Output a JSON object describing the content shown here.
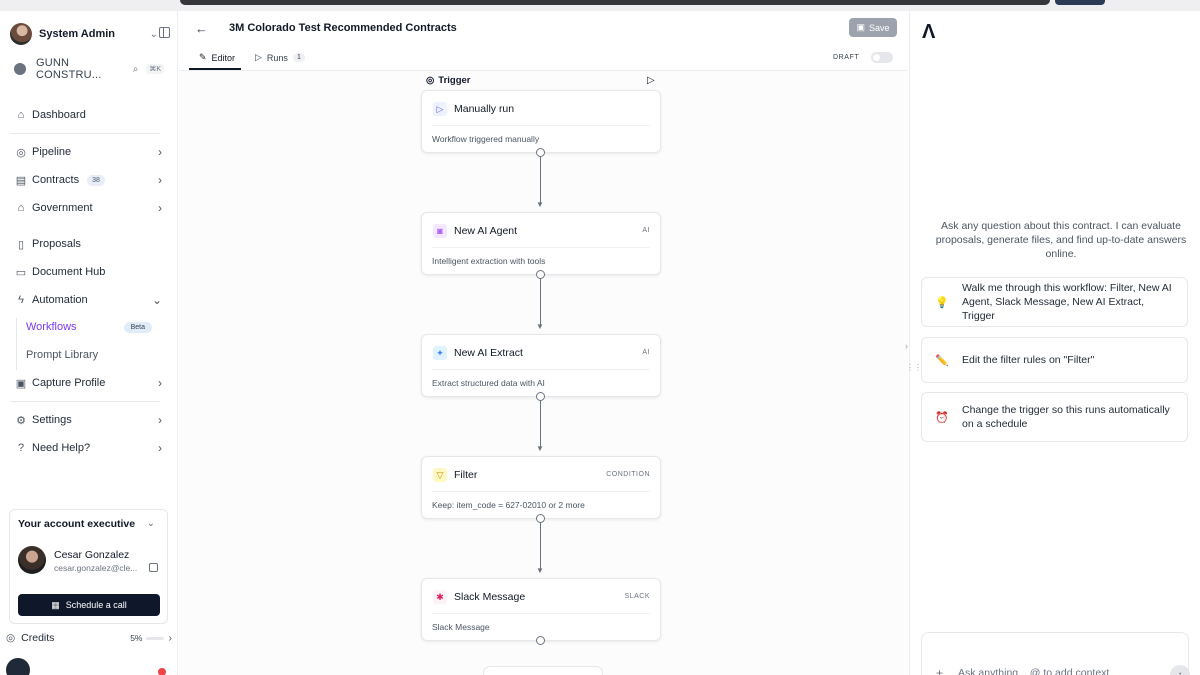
{
  "user": {
    "name": "System Admin"
  },
  "org": {
    "name": "GUNN CONSTRU...",
    "shortcut": "⌘K"
  },
  "nav": {
    "dashboard": "Dashboard",
    "pipeline": "Pipeline",
    "contracts": "Contracts",
    "contracts_count": "38",
    "government": "Government",
    "proposals": "Proposals",
    "document_hub": "Document Hub",
    "automation": "Automation",
    "workflows": "Workflows",
    "workflows_badge": "Beta",
    "prompt_library": "Prompt Library",
    "capture_profile": "Capture Profile",
    "settings": "Settings",
    "need_help": "Need Help?"
  },
  "account_exec": {
    "title": "Your account executive",
    "name": "Cesar Gonzalez",
    "email": "cesar.gonzalez@cle...",
    "button": "Schedule a call"
  },
  "credits": {
    "label": "Credits",
    "percent": "5%"
  },
  "header": {
    "title": "3M Colorado Test Recommended Contracts",
    "save": "Save",
    "tab_editor": "Editor",
    "tab_runs": "Runs",
    "runs_count": "1",
    "status": "DRAFT"
  },
  "workflow": {
    "trigger_label": "Trigger",
    "nodes": [
      {
        "title": "Manually run",
        "tag": "",
        "desc": "Workflow triggered manually",
        "icon": "play-icon",
        "color": "#6366f1"
      },
      {
        "title": "New AI Agent",
        "tag": "AI",
        "desc": "Intelligent extraction with tools",
        "icon": "robot-icon",
        "color": "#a855f7"
      },
      {
        "title": "New AI Extract",
        "tag": "AI",
        "desc": "Extract structured data with AI",
        "icon": "sparkle-icon",
        "color": "#3b82f6"
      },
      {
        "title": "Filter",
        "tag": "CONDITION",
        "desc": "Keep: item_code = 627-02010 or 2 more",
        "icon": "filter-icon",
        "color": "#eab308"
      },
      {
        "title": "Slack Message",
        "tag": "SLACK",
        "desc": "Slack Message",
        "icon": "slack-icon",
        "color": "#e01e5a"
      }
    ]
  },
  "assistant": {
    "logo": "Λ",
    "intro": "Ask any question about this contract. I can evaluate proposals, generate files, and find up-to-date answers online.",
    "suggestions": [
      {
        "icon": "💡",
        "text": "Walk me through this workflow: Filter, New AI Agent, Slack Message, New AI Extract, Trigger"
      },
      {
        "icon": "✏️",
        "text": "Edit the filter rules on \"Filter\""
      },
      {
        "icon": "⏰",
        "text": "Change the trigger so this runs automatically on a schedule"
      }
    ],
    "placeholder": "Ask anything... @ to add context"
  }
}
